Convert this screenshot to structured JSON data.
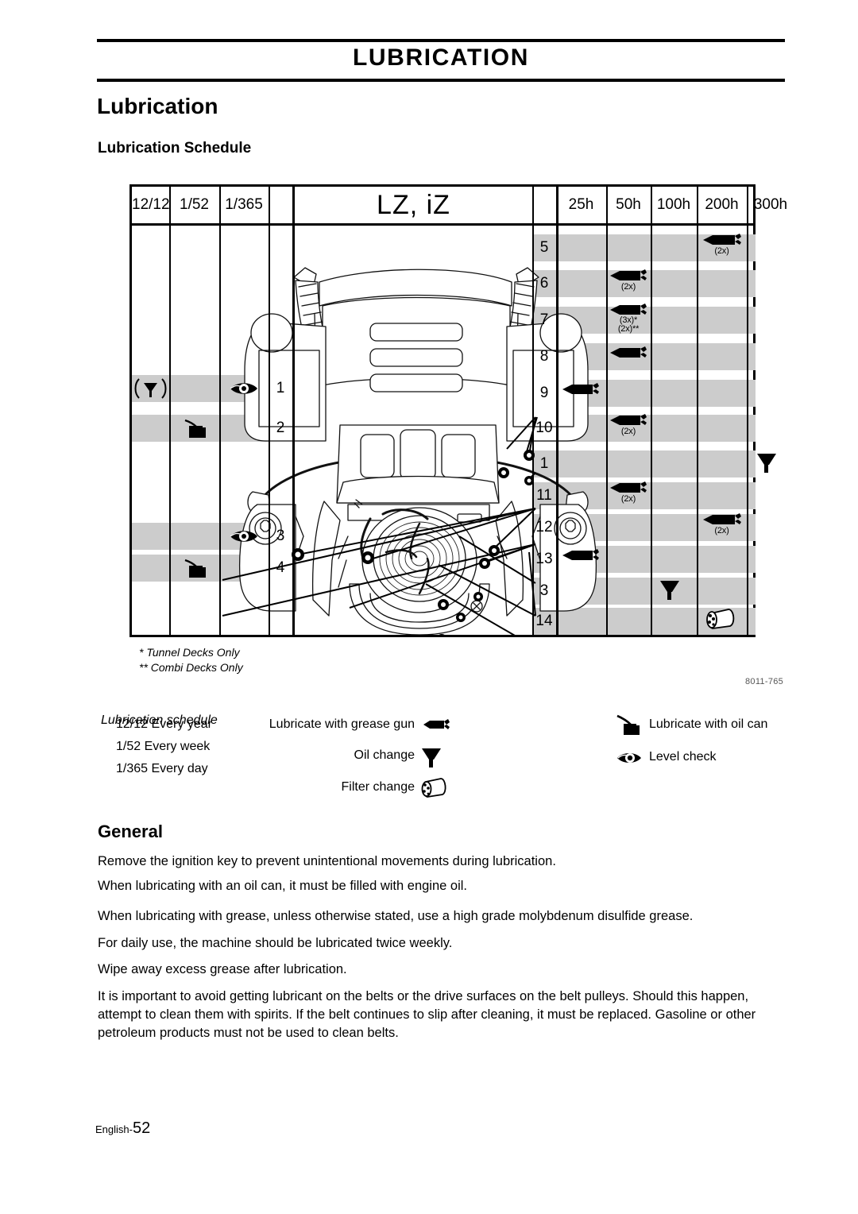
{
  "header": {
    "title": "LUBRICATION"
  },
  "headings": {
    "h1": "Lubrication",
    "h2_schedule": "Lubrication Schedule",
    "h2_general": "General"
  },
  "table": {
    "left_headers": [
      "12/12",
      "1/52",
      "1/365"
    ],
    "center_header": "LZ, iZ",
    "right_headers": [
      "25h",
      "50h",
      "100h",
      "200h",
      "300h"
    ],
    "left_rows": [
      {
        "num": "1",
        "oil_change": true,
        "oil_can": false,
        "level_check": true
      },
      {
        "num": "2",
        "oil_change": false,
        "oil_can": true,
        "level_check": false
      },
      {
        "num": "3",
        "oil_change": false,
        "oil_can": false,
        "level_check": true
      },
      {
        "num": "4",
        "oil_change": false,
        "oil_can": true,
        "level_check": false
      }
    ],
    "right_rows": [
      {
        "num": "5",
        "col": "200h",
        "icon": "grease-gun",
        "mult": "(2x)"
      },
      {
        "num": "6",
        "col": "50h",
        "icon": "grease-gun",
        "mult": "(2x)"
      },
      {
        "num": "7",
        "col": "50h",
        "icon": "grease-gun",
        "mult": "(3x)*",
        "mult2": "(2x)**"
      },
      {
        "num": "8",
        "col": "50h",
        "icon": "grease-gun",
        "mult": ""
      },
      {
        "num": "9",
        "col": "25h",
        "icon": "grease-gun",
        "mult": ""
      },
      {
        "num": "10",
        "col": "50h",
        "icon": "grease-gun",
        "mult": "(2x)"
      },
      {
        "num": "1",
        "col": "300h",
        "icon": "oil-change",
        "mult": ""
      },
      {
        "num": "11",
        "col": "50h",
        "icon": "grease-gun",
        "mult": "(2x)"
      },
      {
        "num": "12",
        "col": "200h",
        "icon": "grease-gun",
        "mult": "(2x)"
      },
      {
        "num": "13",
        "col": "25h",
        "icon": "grease-gun",
        "mult": ""
      },
      {
        "num": "3",
        "col": "100h",
        "icon": "oil-change",
        "mult": ""
      },
      {
        "num": "14",
        "col": "200h",
        "icon": "filter-change",
        "mult": ""
      }
    ]
  },
  "footnotes": {
    "single": "* Tunnel Decks Only",
    "double": "** Combi Decks Only",
    "reference": "8011-765"
  },
  "legend": {
    "title": "Lubrication schedule",
    "intervals": [
      "12/12 Every year",
      "1/52 Every week",
      "1/365 Every day"
    ],
    "center_items": [
      {
        "label": "Lubricate with grease gun",
        "icon": "grease-gun-icon"
      },
      {
        "label": "Oil change",
        "icon": "funnel-icon"
      },
      {
        "label": "Filter change",
        "icon": "filter-icon"
      }
    ],
    "right_items": [
      {
        "label": "Lubricate with oil can",
        "icon": "oil-can-icon"
      },
      {
        "label": "Level check",
        "icon": "eye-icon"
      }
    ]
  },
  "general": {
    "paragraphs": [
      "Remove the ignition key to prevent unintentional movements during lubrication.",
      "When lubricating with an oil can, it must be filled with engine oil.",
      "When lubricating with grease, unless otherwise stated, use a high grade molybdenum disulfide grease.",
      "For daily use, the machine should be lubricated twice weekly.",
      "Wipe away excess grease after lubrication.",
      "It is important to avoid getting lubricant on the belts or the drive surfaces on the belt pulleys. Should this happen, attempt to clean them with spirits. If the belt continues to slip after cleaning, it must be replaced. Gasoline or other petroleum products must not be used to clean belts."
    ]
  },
  "footer": {
    "language": "English-",
    "page": "52"
  }
}
